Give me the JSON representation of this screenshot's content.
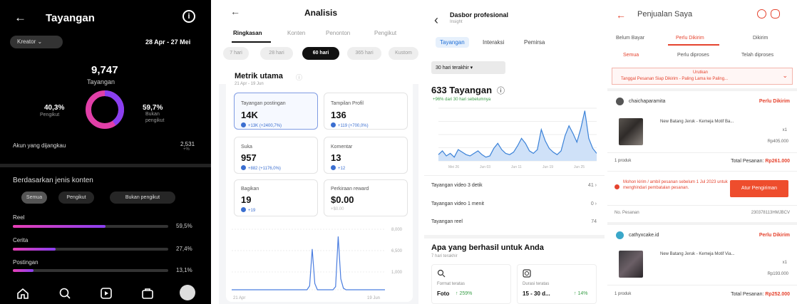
{
  "p1": {
    "title": "Tayangan",
    "back_icon": "←",
    "info_icon": "i",
    "filter": "Kreator ⌄",
    "date_range": "28 Apr - 27 Mei",
    "total": "9,747",
    "total_label": "Tayangan",
    "left_pct": "40,3%",
    "left_label": "Pengikut",
    "right_pct": "59,7%",
    "right_label": "Bukan pengikut",
    "ring": {
      "followers_fraction": 0.403,
      "color_a": "#b23fd6",
      "color_b": "#e13fa8"
    },
    "accounts_label": "Akun yang dijangkau",
    "accounts_value": "2,531",
    "accounts_sub": "+%",
    "section_title": "Berdasarkan jenis konten",
    "chips": [
      "Semua",
      "Pengikut",
      "Bukan pengikut"
    ],
    "categories": [
      {
        "name": "Reel",
        "pct_label": "59,5%",
        "value": 59.5
      },
      {
        "name": "Cerita",
        "pct_label": "27,4%",
        "value": 27.4
      },
      {
        "name": "Postingan",
        "pct_label": "13,1%",
        "value": 13.1
      }
    ],
    "nav_icons": [
      "home-icon",
      "search-icon",
      "reels-icon",
      "shop-icon",
      "profile-icon"
    ]
  },
  "p2": {
    "title": "Analisis",
    "back_icon": "←",
    "tabs": [
      "Ringkasan",
      "Konten",
      "Penonton",
      "Pengikut"
    ],
    "ranges": [
      "7 hari",
      "28 hari",
      "60 hari",
      "365 hari",
      "Kustom"
    ],
    "active_range": 2,
    "metrics_title": "Metrik utama",
    "metrics_range": "21 Apr - 19 Jun",
    "cards": [
      {
        "label": "Tayangan postingan",
        "value": "14K",
        "change": "+13K (+2400,7%)",
        "selected": true
      },
      {
        "label": "Tampilan Profil",
        "value": "136",
        "change": "+119 (+700,0%)",
        "selected": false
      },
      {
        "label": "Suka",
        "value": "957",
        "change": "+882 (+1176,0%)",
        "selected": false
      },
      {
        "label": "Komentar",
        "value": "13",
        "change": "+12",
        "selected": false
      },
      {
        "label": "Bagikan",
        "value": "19",
        "change": "+19",
        "selected": false
      },
      {
        "label": "Perkiraan reward",
        "value": "$0.00",
        "change": "+$0.00",
        "selected": false
      }
    ],
    "chart_y_labels": [
      "8,000",
      "6,500",
      "1,000"
    ],
    "chart_x_labels": [
      "21 Apr",
      "19 Jun"
    ],
    "chart_data": {
      "type": "line",
      "values": [
        0,
        0,
        0,
        0,
        0,
        0,
        0,
        0,
        0,
        0,
        0,
        0,
        0,
        0,
        0,
        0,
        0,
        0,
        0,
        0,
        0,
        0,
        0,
        0,
        0,
        0,
        0,
        0,
        0,
        0,
        500,
        5200,
        800,
        0,
        0,
        0,
        0,
        0,
        0,
        0,
        400,
        6800,
        1400,
        200,
        0,
        0,
        0,
        0,
        0,
        0,
        0,
        0,
        0,
        0,
        0,
        0,
        0,
        0,
        0,
        0
      ]
    }
  },
  "p3": {
    "title": "Dasbor profesional",
    "subtitle": "Insight",
    "back_icon": "‹",
    "tabs": [
      "Tayangan",
      "Interaksi",
      "Pemirsa"
    ],
    "dropdown": "30 hari terakhir ▾",
    "big": "633 Tayangan",
    "growth": "+96% dari 30 hari sebelumnya",
    "x_labels": [
      "Mei 26",
      "Jun 03",
      "Jun 11",
      "Jun 19",
      "Jun 25"
    ],
    "chart_data": {
      "type": "area",
      "values": [
        5,
        8,
        4,
        6,
        3,
        9,
        7,
        5,
        4,
        6,
        8,
        5,
        3,
        4,
        10,
        14,
        9,
        6,
        5,
        7,
        12,
        18,
        14,
        8,
        6,
        9,
        25,
        16,
        10,
        7,
        5,
        8,
        20,
        28,
        22,
        15,
        26,
        40,
        18,
        10,
        6
      ]
    },
    "rows": [
      {
        "label": "Tayangan video 3 detik",
        "value": "41"
      },
      {
        "label": "Tayangan video 1 menit",
        "value": "0"
      },
      {
        "label": "Tayangan reel",
        "value": "74"
      }
    ],
    "work_title": "Apa yang berhasil untuk Anda",
    "work_sub": "7 hari terakhir",
    "boxes": [
      {
        "label": "Format teratas",
        "value": "Foto",
        "change": "↑ 259%"
      },
      {
        "label": "Durasi teratas",
        "value": "15 - 30 d...",
        "change": "↑ 14%"
      }
    ]
  },
  "p4": {
    "title": "Penjualan Saya",
    "back_icon": "←",
    "tabs": [
      "Belum Bayar",
      "Perlu Dikirim",
      "Dikirim"
    ],
    "subtabs": [
      "Semua",
      "Perlu diproses",
      "Telah diproses"
    ],
    "alert_line1": "Urutkan",
    "alert_line2": "Tanggal Pesanan Siap Dikirim - Paling Lama ke Paling...",
    "orders": [
      {
        "shop": "chaichaparamita",
        "status": "Perlu Dikirim",
        "product": "New Batang Jeruk - Kemeja Motif Ba...",
        "qty": "x1",
        "price": "Rp405.000",
        "count": "1 produk",
        "total_label": "Total Pesanan:",
        "total": "Rp261.000"
      },
      {
        "shop": "cathyxcake.id",
        "status": "Perlu Dikirim",
        "product": "New Batang Jeruk - Kemeja Motif Via...",
        "qty": "x1",
        "price": "Rp193.000",
        "count": "1 produk",
        "total_label": "Total Pesanan:",
        "total": "Rp252.000"
      }
    ],
    "warning": "Mohon kirim / ambil pesanan sebelum 1 Jul 2023 untuk menghindari pembatalan pesanan.",
    "action": "Atur Pengiriman",
    "order_no_label": "No. Pesanan",
    "order_no": "230378113HMJBCV"
  }
}
